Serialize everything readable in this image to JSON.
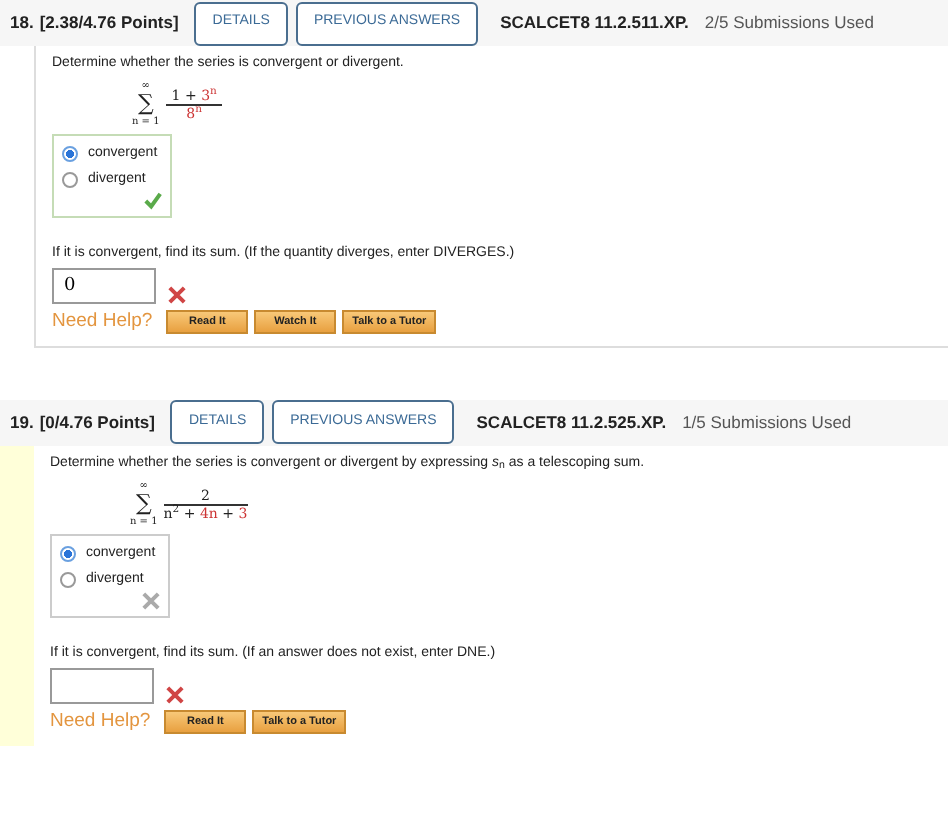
{
  "questions": [
    {
      "number": "18.",
      "points": "[2.38/4.76 Points]",
      "buttons": [
        "DETAILS",
        "PREVIOUS ANSWERS"
      ],
      "code": "SCALCET8 11.2.511.XP.",
      "submissions": "2/5 Submissions Used",
      "highlighted": false,
      "prompt": "Determine whether the series is convergent or divergent.",
      "series": {
        "operator": "∑",
        "upper": "∞",
        "lower": "n = 1",
        "numerator": [
          {
            "text": "1 + ",
            "highlighted": false
          },
          {
            "text": "3$^{n}$",
            "highlighted": true
          }
        ],
        "denominator": [
          {
            "text": "8$^{n}$",
            "highlighted": true
          }
        ]
      },
      "choices": [
        {
          "label": "convergent",
          "selected": true
        },
        {
          "label": "divergent",
          "selected": false
        }
      ],
      "choice_correct": true,
      "sum_prompt": "If it is convergent, find its sum. (If the quantity diverges, enter DIVERGES.)",
      "sum_value": "0",
      "sum_correct": false,
      "help_label": "Need Help?",
      "help_buttons": [
        "Read It",
        "Watch It",
        "Talk to a Tutor"
      ]
    },
    {
      "number": "19.",
      "points": "[0/4.76 Points]",
      "buttons": [
        "DETAILS",
        "PREVIOUS ANSWERS"
      ],
      "code": "SCALCET8 11.2.525.XP.",
      "submissions": "1/5 Submissions Used",
      "highlighted": true,
      "prompt": "Determine whether the series is convergent or divergent by expressing *s*$_{n}$ as a telescoping sum.",
      "series": {
        "operator": "∑",
        "upper": "∞",
        "lower": "n = 1",
        "numerator": [
          {
            "text": "2",
            "highlighted": false
          }
        ],
        "denominator": [
          {
            "text": "n$^{2}$ + ",
            "highlighted": false
          },
          {
            "text": "4n",
            "highlighted": true
          },
          {
            "text": " + ",
            "highlighted": false
          },
          {
            "text": "3",
            "highlighted": true
          }
        ]
      },
      "choices": [
        {
          "label": "convergent",
          "selected": true
        },
        {
          "label": "divergent",
          "selected": false
        }
      ],
      "choice_correct": false,
      "sum_prompt": "If it is convergent, find its sum. (If an answer does not exist, enter DNE.)",
      "sum_correct": false,
      "help_label": "Need Help?",
      "help_buttons": [
        "Read It",
        "Talk to a Tutor"
      ]
    }
  ]
}
